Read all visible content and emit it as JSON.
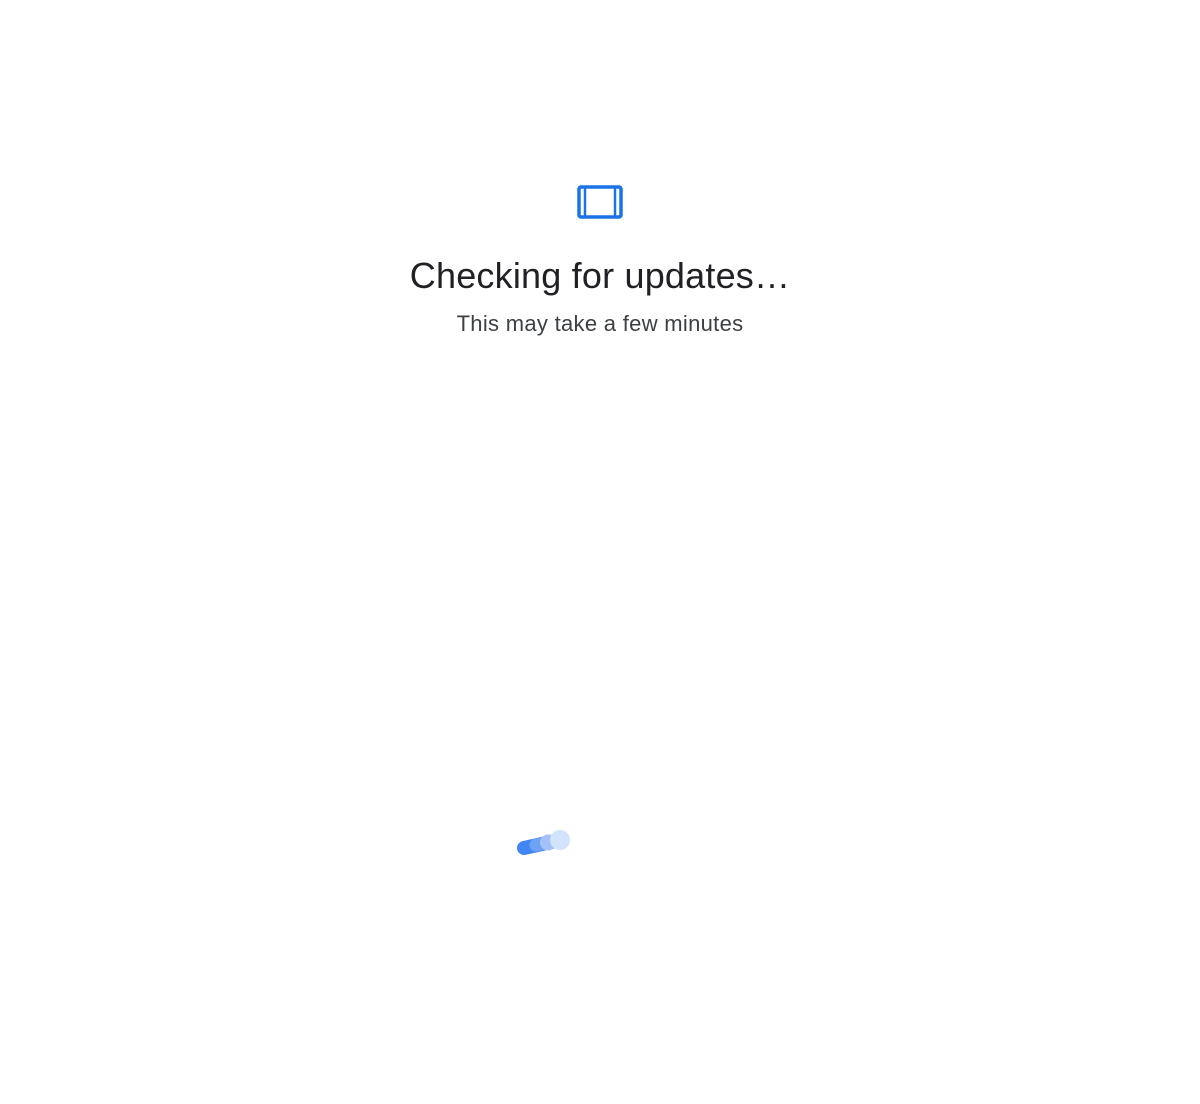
{
  "screen": {
    "icon": "device-frame-icon",
    "title": "Checking for updates…",
    "subtitle": "This may take a few minutes",
    "loading_indicator": "loading-dots-icon"
  },
  "colors": {
    "background": "#ffffff",
    "accent": "#1a73e8",
    "title_text": "#202124",
    "subtitle_text": "#3c4043",
    "spinner_dark": "#4285f4",
    "spinner_mid": "#8ab4f8",
    "spinner_light": "#d2e3fc"
  }
}
